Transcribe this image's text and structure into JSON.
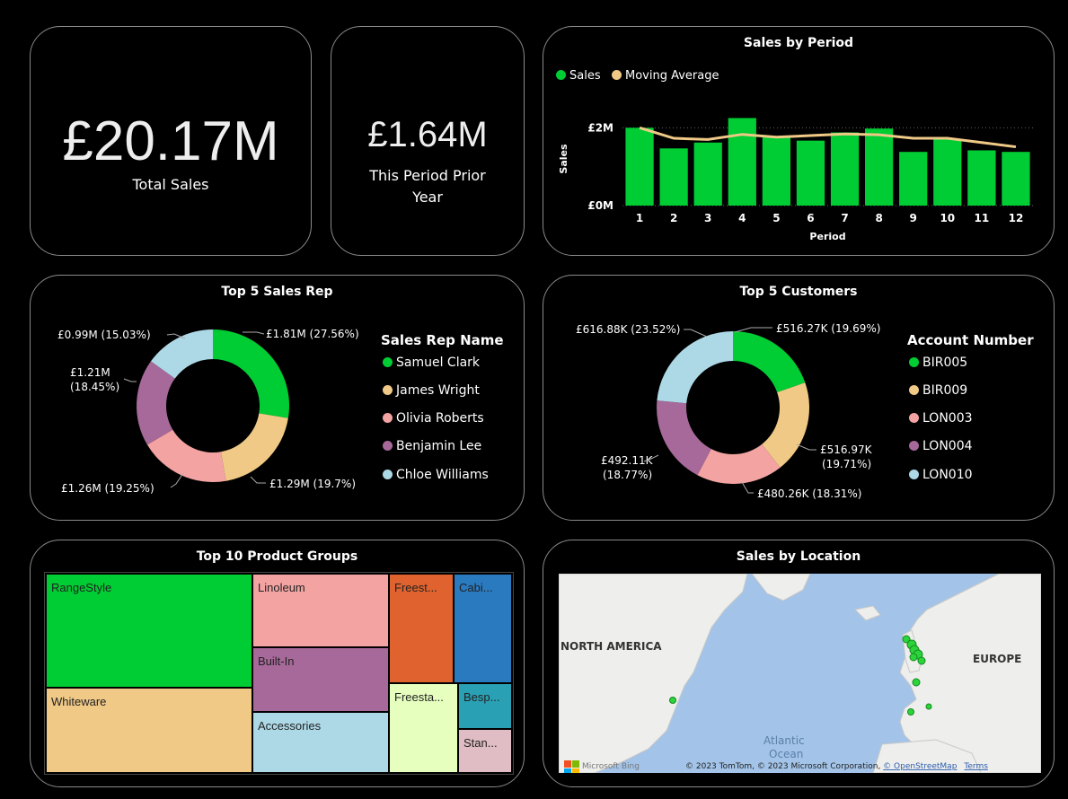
{
  "kpi_total": {
    "value": "£20.17M",
    "label": "Total Sales"
  },
  "kpi_prior": {
    "value": "£1.64M",
    "label_line1": "This Period Prior",
    "label_line2": "Year"
  },
  "sales_by_period": {
    "title": "Sales by Period",
    "legend": [
      {
        "label": "Sales",
        "color": "#00cc33"
      },
      {
        "label": "Moving Average",
        "color": "#f0c987"
      }
    ]
  },
  "chart_data": [
    {
      "type": "bar",
      "title": "Sales by Period",
      "xlabel": "Period",
      "ylabel": "Sales",
      "categories": [
        "1",
        "2",
        "3",
        "4",
        "5",
        "6",
        "7",
        "8",
        "9",
        "10",
        "11",
        "12"
      ],
      "series": [
        {
          "name": "Sales",
          "type": "bar",
          "color": "#00cc33",
          "values": [
            2.0,
            1.47,
            1.62,
            2.25,
            1.76,
            1.67,
            1.88,
            1.98,
            1.38,
            1.71,
            1.42,
            1.38
          ]
        },
        {
          "name": "Moving Average",
          "type": "line",
          "color": "#f0c987",
          "values": [
            2.0,
            1.73,
            1.7,
            1.83,
            1.76,
            1.8,
            1.84,
            1.82,
            1.73,
            1.73,
            1.62,
            1.51
          ]
        }
      ],
      "ylim": [
        0,
        2.4
      ],
      "yticks": [
        {
          "value": 0,
          "label": "£0M"
        },
        {
          "value": 2,
          "label": "£2M"
        }
      ],
      "grid": true,
      "legend_position": "top-left"
    },
    {
      "type": "pie",
      "title": "Top 5 Sales Rep",
      "legend_title": "Sales Rep Name",
      "slices": [
        {
          "name": "Samuel Clark",
          "value": 1.81,
          "label": "£1.81M (27.56%)",
          "color": "#00cc33"
        },
        {
          "name": "James Wright",
          "value": 1.29,
          "label": "£1.29M (19.7%)",
          "color": "#f0c987"
        },
        {
          "name": "Olivia Roberts",
          "value": 1.26,
          "label": "£1.26M (19.25%)",
          "color": "#f4a3a3"
        },
        {
          "name": "Benjamin Lee",
          "value": 1.21,
          "label": "£1.21M (18.45%)",
          "color": "#a66999"
        },
        {
          "name": "Chloe Williams",
          "value": 0.99,
          "label": "£0.99M (15.03%)",
          "color": "#add8e6"
        }
      ]
    },
    {
      "type": "pie",
      "title": "Top 5 Customers",
      "legend_title": "Account Number",
      "slices": [
        {
          "name": "BIR005",
          "value": 516.27,
          "label": "£516.27K (19.69%)",
          "color": "#00cc33"
        },
        {
          "name": "BIR009",
          "value": 516.97,
          "label": "£516.97K (19.71%)",
          "color": "#f0c987"
        },
        {
          "name": "LON003",
          "value": 480.26,
          "label": "£480.26K (18.31%)",
          "color": "#f4a3a3"
        },
        {
          "name": "LON004",
          "value": 492.11,
          "label": "£492.11K (18.77%)",
          "color": "#a66999"
        },
        {
          "name": "LON010",
          "value": 616.88,
          "label": "£616.88K (23.52%)",
          "color": "#add8e6"
        }
      ]
    }
  ],
  "sales_rep": {
    "title": "Top 5 Sales Rep",
    "legend_title": "Sales Rep Name",
    "labels": {
      "l0": "£1.81M (27.56%)",
      "l1": "£1.29M (19.7%)",
      "l2": "£1.26M (19.25%)",
      "l3a": "£1.21M",
      "l3b": "(18.45%)",
      "l4": "£0.99M (15.03%)"
    },
    "names": [
      "Samuel Clark",
      "James Wright",
      "Olivia Roberts",
      "Benjamin Lee",
      "Chloe Williams"
    ]
  },
  "customers": {
    "title": "Top 5 Customers",
    "legend_title": "Account Number",
    "labels": {
      "l0": "£516.27K (19.69%)",
      "l1a": "£516.97K",
      "l1b": "(19.71%)",
      "l2": "£480.26K (18.31%)",
      "l3a": "£492.11K",
      "l3b": "(18.77%)",
      "l4": "£616.88K (23.52%)"
    },
    "names": [
      "BIR005",
      "BIR009",
      "LON003",
      "LON004",
      "LON010"
    ]
  },
  "colors": [
    "#00cc33",
    "#f0c987",
    "#f4a3a3",
    "#a66999",
    "#add8e6"
  ],
  "product_groups": {
    "title": "Top 10 Product Groups",
    "items": [
      {
        "label": "RangeStyle",
        "color": "#00cc33"
      },
      {
        "label": "Whiteware",
        "color": "#f0c987"
      },
      {
        "label": "Linoleum",
        "color": "#f4a3a3"
      },
      {
        "label": "Built-In",
        "color": "#a66999"
      },
      {
        "label": "Accessories",
        "color": "#add8e6"
      },
      {
        "label": "Freest...",
        "color": "#e0622e"
      },
      {
        "label": "Freesta...",
        "color": "#e6ffbf"
      },
      {
        "label": "Cabi...",
        "color": "#2a7ac0"
      },
      {
        "label": "Besp...",
        "color": "#2aa0b4"
      },
      {
        "label": "Stan...",
        "color": "#e0bcc4"
      }
    ]
  },
  "location": {
    "title": "Sales by Location",
    "map_labels": {
      "na": "NORTH AMERICA",
      "eu": "EUROPE",
      "atlantic_1": "Atlantic",
      "atlantic_2": "Ocean"
    },
    "bing": "Microsoft Bing",
    "copyright": "© 2023 TomTom, © 2023 Microsoft Corporation, ",
    "osm": "© OpenStreetMap",
    "terms": "Terms"
  }
}
